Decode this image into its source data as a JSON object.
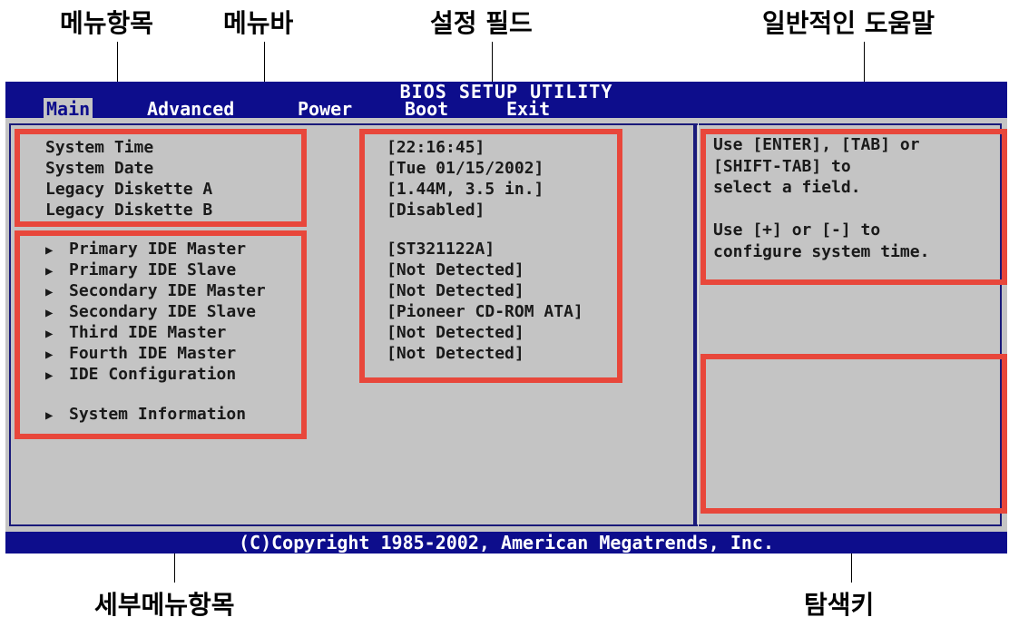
{
  "callouts": {
    "menu_item": "메뉴항목",
    "menu_bar": "메뉴바",
    "config_fields": "설정 필드",
    "general_help": "일반적인 도움말",
    "submenu_item": "세부메뉴항목",
    "navigation_keys": "탐색키"
  },
  "bios": {
    "title": "BIOS SETUP UTILITY",
    "menu": [
      "Main",
      "Advanced",
      "Power",
      "Boot",
      "Exit"
    ],
    "active_menu": "Main",
    "items": [
      {
        "label": "System Time",
        "value": "[22:16:45]"
      },
      {
        "label": "System Date",
        "value": "[Tue 01/15/2002]"
      },
      {
        "label": "Legacy Diskette A",
        "value": "[1.44M, 3.5 in.]"
      },
      {
        "label": "Legacy Diskette B",
        "value": "[Disabled]"
      }
    ],
    "submenus": [
      {
        "label": "Primary IDE Master",
        "value": "[ST321122A]"
      },
      {
        "label": "Primary IDE Slave",
        "value": "[Not Detected]"
      },
      {
        "label": "Secondary IDE Master",
        "value": "[Not Detected]"
      },
      {
        "label": "Secondary IDE Slave",
        "value": "[Pioneer CD-ROM ATA]"
      },
      {
        "label": "Third IDE Master",
        "value": "[Not Detected]"
      },
      {
        "label": "Fourth IDE Master",
        "value": "[Not Detected]"
      },
      {
        "label": "IDE Configuration",
        "value": ""
      },
      {
        "label": "System Information",
        "value": ""
      }
    ],
    "help_lines": [
      "Use [ENTER], [TAB] or",
      "[SHIFT-TAB] to",
      "select a field.",
      "",
      "Use [+] or [-] to",
      "configure system time."
    ],
    "footer": "(C)Copyright 1985-2002, American Megatrends, Inc.",
    "submenu_icon": "right-triangle-icon",
    "colors": {
      "bar": "#0d0d8c",
      "panel": "#c4c4c4",
      "highlight": "#e8473b"
    }
  }
}
